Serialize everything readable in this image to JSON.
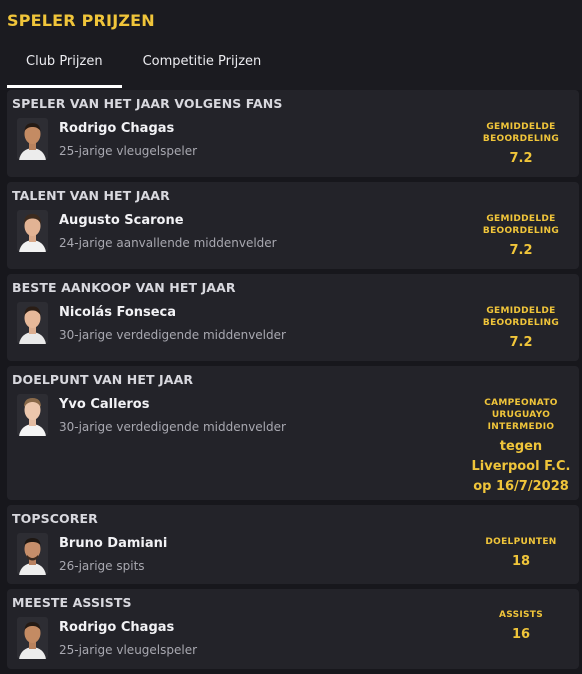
{
  "page": {
    "title": "SPELER PRIJZEN"
  },
  "tabs": [
    {
      "label": "Club Prijzen",
      "active": true
    },
    {
      "label": "Competitie Prijzen",
      "active": false
    }
  ],
  "colors": {
    "accent": "#f0c53a",
    "card": "#232329",
    "background": "#17171c"
  },
  "awards": [
    {
      "title": "SPELER VAN HET JAAR VOLGENS FANS",
      "player": "Rodrigo Chagas",
      "description": "25-jarige vleugelspeler",
      "stat_label": "GEMIDDELDE BEOORDELING",
      "stat_value": "7.2"
    },
    {
      "title": "TALENT VAN HET JAAR",
      "player": "Augusto Scarone",
      "description": "24-jarige aanvallende middenvelder",
      "stat_label": "GEMIDDELDE BEOORDELING",
      "stat_value": "7.2"
    },
    {
      "title": "BESTE AANKOOP VAN HET JAAR",
      "player": "Nicolás Fonseca",
      "description": "30-jarige verdedigende middenvelder",
      "stat_label": "GEMIDDELDE BEOORDELING",
      "stat_value": "7.2"
    },
    {
      "title": "DOELPUNT VAN HET JAAR",
      "player": "Yvo Calleros",
      "description": "30-jarige verdedigende middenvelder",
      "stat_label": "CAMPEONATO URUGUAYO INTERMEDIO",
      "stat_value": "tegen Liverpool F.C. op 16/7/2028"
    },
    {
      "title": "TOPSCORER",
      "player": "Bruno Damiani",
      "description": "26-jarige spits",
      "stat_label": "DOELPUNTEN",
      "stat_value": "18"
    },
    {
      "title": "MEESTE ASSISTS",
      "player": "Rodrigo Chagas",
      "description": "25-jarige vleugelspeler",
      "stat_label": "ASSISTS",
      "stat_value": "16"
    }
  ]
}
